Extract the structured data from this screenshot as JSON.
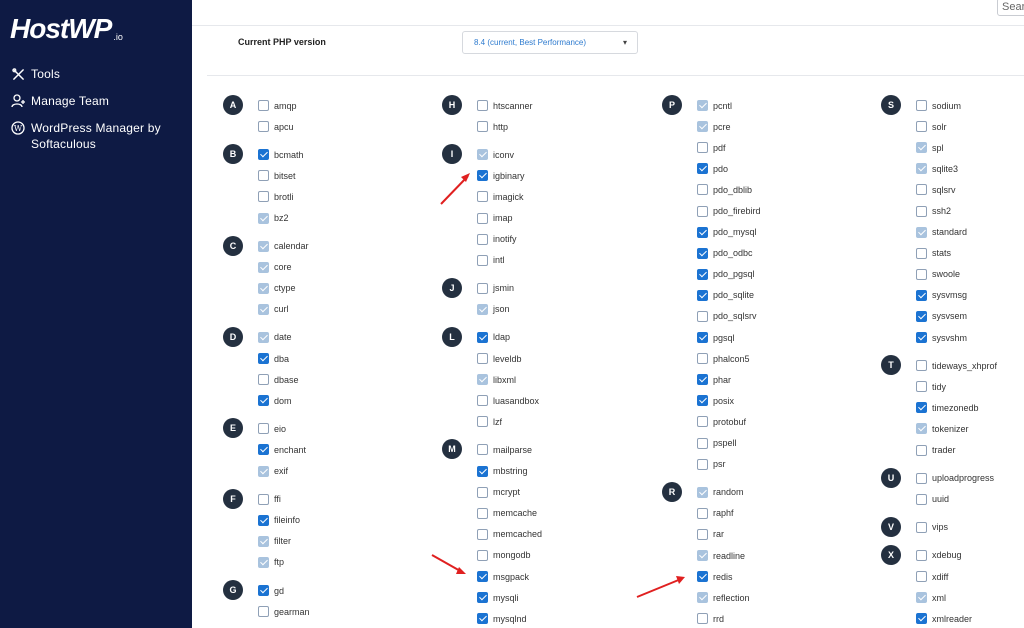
{
  "brand": {
    "logo_text": "HostWP",
    "logo_suffix": ".io"
  },
  "sidebar": {
    "items": [
      {
        "label": "Tools",
        "icon": "tools-icon"
      },
      {
        "label": "Manage Team",
        "icon": "user-add-icon"
      },
      {
        "label": "WordPress Manager by Softaculous",
        "icon": "wordpress-icon"
      }
    ]
  },
  "search": {
    "value": "Sear"
  },
  "php": {
    "label": "Current PHP version",
    "selected": "8.4 (current, Best Performance)"
  },
  "colors": {
    "sidebar_bg": "#0e1a44",
    "checkbox_checked": "#1b73d2",
    "checkbox_disabled": "#a9c3de",
    "arrow": "#e02020"
  },
  "columns": [
    [
      {
        "letter": "A",
        "items": [
          {
            "name": "amqp",
            "state": "unchecked"
          },
          {
            "name": "apcu",
            "state": "unchecked"
          }
        ]
      },
      {
        "letter": "B",
        "items": [
          {
            "name": "bcmath",
            "state": "checked"
          },
          {
            "name": "bitset",
            "state": "unchecked"
          },
          {
            "name": "brotli",
            "state": "unchecked"
          },
          {
            "name": "bz2",
            "state": "disabled"
          }
        ]
      },
      {
        "letter": "C",
        "items": [
          {
            "name": "calendar",
            "state": "disabled"
          },
          {
            "name": "core",
            "state": "disabled"
          },
          {
            "name": "ctype",
            "state": "disabled"
          },
          {
            "name": "curl",
            "state": "disabled"
          }
        ]
      },
      {
        "letter": "D",
        "items": [
          {
            "name": "date",
            "state": "disabled"
          },
          {
            "name": "dba",
            "state": "checked"
          },
          {
            "name": "dbase",
            "state": "unchecked"
          },
          {
            "name": "dom",
            "state": "checked"
          }
        ]
      },
      {
        "letter": "E",
        "items": [
          {
            "name": "eio",
            "state": "unchecked"
          },
          {
            "name": "enchant",
            "state": "checked"
          },
          {
            "name": "exif",
            "state": "disabled"
          }
        ]
      },
      {
        "letter": "F",
        "items": [
          {
            "name": "ffi",
            "state": "unchecked"
          },
          {
            "name": "fileinfo",
            "state": "checked"
          },
          {
            "name": "filter",
            "state": "disabled"
          },
          {
            "name": "ftp",
            "state": "disabled"
          }
        ]
      },
      {
        "letter": "G",
        "items": [
          {
            "name": "gd",
            "state": "checked"
          },
          {
            "name": "gearman",
            "state": "unchecked"
          }
        ]
      }
    ],
    [
      {
        "letter": "H",
        "items": [
          {
            "name": "htscanner",
            "state": "unchecked"
          },
          {
            "name": "http",
            "state": "unchecked"
          }
        ]
      },
      {
        "letter": "I",
        "items": [
          {
            "name": "iconv",
            "state": "disabled"
          },
          {
            "name": "igbinary",
            "state": "checked"
          },
          {
            "name": "imagick",
            "state": "unchecked"
          },
          {
            "name": "imap",
            "state": "unchecked"
          },
          {
            "name": "inotify",
            "state": "unchecked"
          },
          {
            "name": "intl",
            "state": "unchecked"
          }
        ]
      },
      {
        "letter": "J",
        "items": [
          {
            "name": "jsmin",
            "state": "unchecked"
          },
          {
            "name": "json",
            "state": "disabled"
          }
        ]
      },
      {
        "letter": "L",
        "items": [
          {
            "name": "ldap",
            "state": "checked"
          },
          {
            "name": "leveldb",
            "state": "unchecked"
          },
          {
            "name": "libxml",
            "state": "disabled"
          },
          {
            "name": "luasandbox",
            "state": "unchecked"
          },
          {
            "name": "lzf",
            "state": "unchecked"
          }
        ]
      },
      {
        "letter": "M",
        "items": [
          {
            "name": "mailparse",
            "state": "unchecked"
          },
          {
            "name": "mbstring",
            "state": "checked"
          },
          {
            "name": "mcrypt",
            "state": "unchecked"
          },
          {
            "name": "memcache",
            "state": "unchecked"
          },
          {
            "name": "memcached",
            "state": "unchecked"
          },
          {
            "name": "mongodb",
            "state": "unchecked"
          },
          {
            "name": "msgpack",
            "state": "checked"
          },
          {
            "name": "mysqli",
            "state": "checked"
          },
          {
            "name": "mysqlnd",
            "state": "checked"
          }
        ]
      }
    ],
    [
      {
        "letter": "P",
        "items": [
          {
            "name": "pcntl",
            "state": "disabled"
          },
          {
            "name": "pcre",
            "state": "disabled"
          },
          {
            "name": "pdf",
            "state": "unchecked"
          },
          {
            "name": "pdo",
            "state": "checked"
          },
          {
            "name": "pdo_dblib",
            "state": "unchecked"
          },
          {
            "name": "pdo_firebird",
            "state": "unchecked"
          },
          {
            "name": "pdo_mysql",
            "state": "checked"
          },
          {
            "name": "pdo_odbc",
            "state": "checked"
          },
          {
            "name": "pdo_pgsql",
            "state": "checked"
          },
          {
            "name": "pdo_sqlite",
            "state": "checked"
          },
          {
            "name": "pdo_sqlsrv",
            "state": "unchecked"
          },
          {
            "name": "pgsql",
            "state": "checked"
          },
          {
            "name": "phalcon5",
            "state": "unchecked"
          },
          {
            "name": "phar",
            "state": "checked"
          },
          {
            "name": "posix",
            "state": "checked"
          },
          {
            "name": "protobuf",
            "state": "unchecked"
          },
          {
            "name": "pspell",
            "state": "unchecked"
          },
          {
            "name": "psr",
            "state": "unchecked"
          }
        ]
      },
      {
        "letter": "R",
        "items": [
          {
            "name": "random",
            "state": "disabled"
          },
          {
            "name": "raphf",
            "state": "unchecked"
          },
          {
            "name": "rar",
            "state": "unchecked"
          },
          {
            "name": "readline",
            "state": "disabled"
          },
          {
            "name": "redis",
            "state": "checked"
          },
          {
            "name": "reflection",
            "state": "disabled"
          },
          {
            "name": "rrd",
            "state": "unchecked"
          }
        ]
      }
    ],
    [
      {
        "letter": "S",
        "items": [
          {
            "name": "sodium",
            "state": "unchecked"
          },
          {
            "name": "solr",
            "state": "unchecked"
          },
          {
            "name": "spl",
            "state": "disabled"
          },
          {
            "name": "sqlite3",
            "state": "disabled"
          },
          {
            "name": "sqlsrv",
            "state": "unchecked"
          },
          {
            "name": "ssh2",
            "state": "unchecked"
          },
          {
            "name": "standard",
            "state": "disabled"
          },
          {
            "name": "stats",
            "state": "unchecked"
          },
          {
            "name": "swoole",
            "state": "unchecked"
          },
          {
            "name": "sysvmsg",
            "state": "checked"
          },
          {
            "name": "sysvsem",
            "state": "checked"
          },
          {
            "name": "sysvshm",
            "state": "checked"
          }
        ]
      },
      {
        "letter": "T",
        "items": [
          {
            "name": "tideways_xhprof",
            "state": "unchecked"
          },
          {
            "name": "tidy",
            "state": "unchecked"
          },
          {
            "name": "timezonedb",
            "state": "checked"
          },
          {
            "name": "tokenizer",
            "state": "disabled"
          },
          {
            "name": "trader",
            "state": "unchecked"
          }
        ]
      },
      {
        "letter": "U",
        "items": [
          {
            "name": "uploadprogress",
            "state": "unchecked"
          },
          {
            "name": "uuid",
            "state": "unchecked"
          }
        ]
      },
      {
        "letter": "V",
        "items": [
          {
            "name": "vips",
            "state": "unchecked"
          }
        ]
      },
      {
        "letter": "X",
        "items": [
          {
            "name": "xdebug",
            "state": "unchecked"
          },
          {
            "name": "xdiff",
            "state": "unchecked"
          },
          {
            "name": "xml",
            "state": "disabled"
          },
          {
            "name": "xmlreader",
            "state": "checked"
          }
        ]
      }
    ]
  ]
}
